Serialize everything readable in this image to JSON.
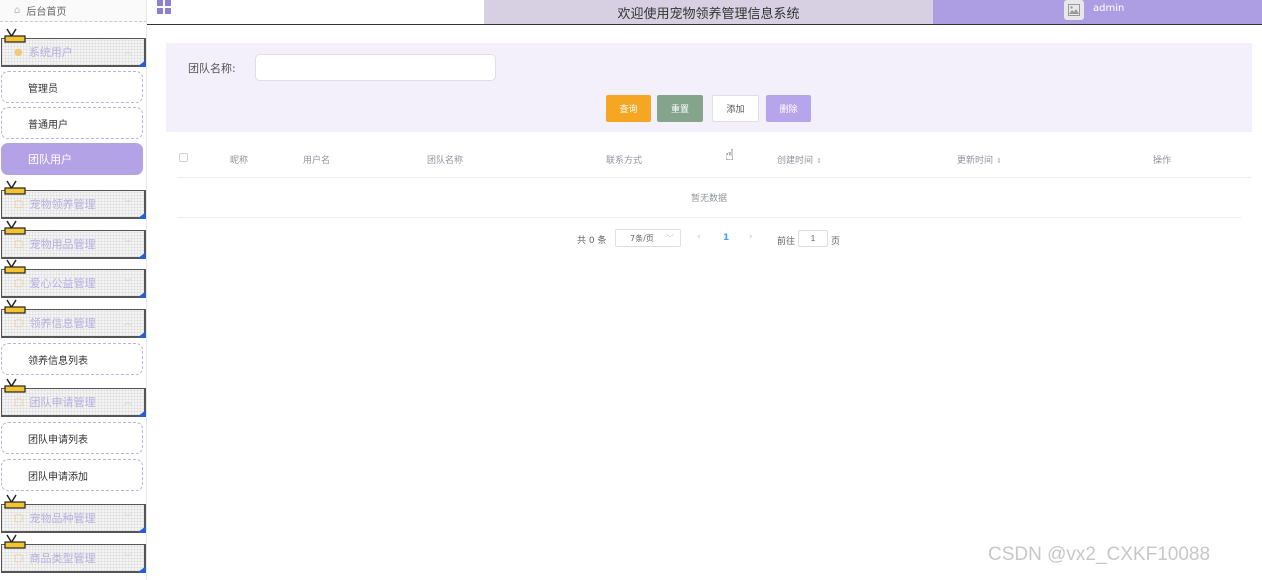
{
  "header": {
    "title": "欢迎使用宠物领养管理信息系统",
    "username": "admin"
  },
  "sidebar": {
    "home": "后台首页",
    "groups": [
      {
        "label": "系统用户",
        "items": [
          "管理员",
          "普通用户",
          "团队用户"
        ],
        "active_item": "团队用户"
      },
      {
        "label": "宠物领养管理",
        "items": []
      },
      {
        "label": "宠物用品管理",
        "items": []
      },
      {
        "label": "爱心公益管理",
        "items": []
      },
      {
        "label": "领养信息管理",
        "items": [
          "领养信息列表"
        ]
      },
      {
        "label": "团队申请管理",
        "items": [
          "团队申请列表",
          "团队申请添加"
        ]
      },
      {
        "label": "宠物品种管理",
        "items": []
      },
      {
        "label": "商品类型管理",
        "items": []
      }
    ]
  },
  "search": {
    "label": "团队名称:",
    "value": "",
    "placeholder": ""
  },
  "buttons": {
    "query": "查询",
    "reset": "重置",
    "add": "添加",
    "delete": "删除"
  },
  "table": {
    "columns": [
      "昵称",
      "用户名",
      "团队名称",
      "联系方式",
      "创建时间",
      "更新时间",
      "操作"
    ],
    "empty_text": "暂无数据"
  },
  "pagination": {
    "total": "共 0 条",
    "page_size": "7条/页",
    "current_page": "1",
    "goto_label": "前往",
    "goto_value": "1",
    "page_unit": "页"
  },
  "watermark": "CSDN @vx2_CXKF10088",
  "colors": {
    "accent": "#ad9ee3",
    "active_menu": "#b3a2e6",
    "query_button": "#f5a623",
    "reset_button": "#84a48c",
    "delete_button": "#b6a5ea",
    "search_panel": "#f3f0fb"
  }
}
